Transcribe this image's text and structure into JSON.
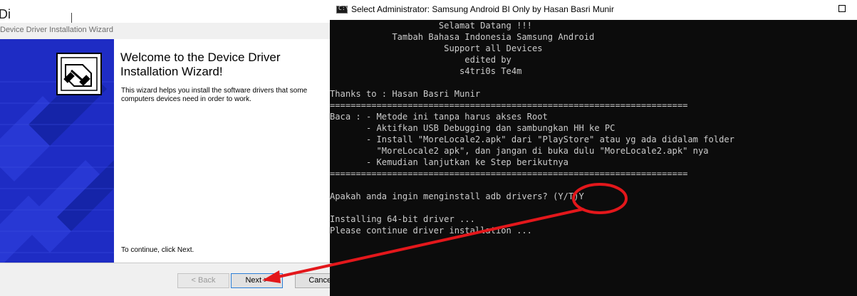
{
  "wizard": {
    "window_title": "Device Driver Installation Wizard",
    "background_fragment": "Di",
    "heading": "Welcome to the Device Driver Installation Wizard!",
    "description": "This wizard helps you install the software drivers that some computers devices need in order to work.",
    "footer_text": "To continue, click Next.",
    "buttons": {
      "back": "< Back",
      "next": "Next >",
      "cancel": "Cancel"
    },
    "banner_color": "#1e2cc4"
  },
  "console": {
    "title": "Select Administrator:  Samsung Android BI Only by Hasan Basri Munir",
    "icon_glyph": "C:\\",
    "lines": [
      "                     Selamat Datang !!!",
      "            Tambah Bahasa Indonesia Samsung Android",
      "                      Support all Devices",
      "                          edited by",
      "                         s4tri0s Te4m",
      "",
      "Thanks to : Hasan Basri Munir",
      "=====================================================================",
      "Baca : - Metode ini tanpa harus akses Root",
      "       - Aktifkan USB Debugging dan sambungkan HH ke PC",
      "       - Install \"MoreLocale2.apk\" dari \"PlayStore\" atau yg ada didalam folder",
      "         \"MoreLocale2 apk\", dan jangan di buka dulu \"MoreLocale2.apk\" nya",
      "       - Kemudian lanjutkan ke Step berikutnya",
      "=====================================================================",
      "",
      "Apakah anda ingin menginstall adb drivers? (Y/T)Y",
      "",
      "Installing 64-bit driver ...",
      "Please continue driver installation ..."
    ],
    "text_color": "#cccccc",
    "background_color": "#0c0c0c"
  },
  "annotation": {
    "color": "#e3171b",
    "shapes": [
      "circle-highlight",
      "arrow"
    ]
  }
}
